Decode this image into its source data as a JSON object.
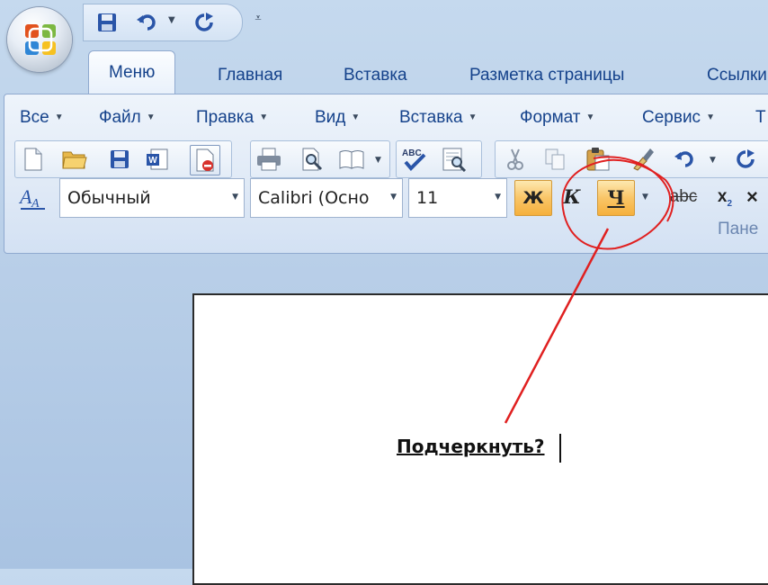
{
  "quick_access": {
    "items": [
      "save-icon",
      "undo-icon",
      "redo-icon"
    ],
    "customize_icon": "customize-qat-icon"
  },
  "tabs": [
    "Меню",
    "Главная",
    "Вставка",
    "Разметка страницы",
    "Ссылки"
  ],
  "menu": [
    "Все",
    "Файл",
    "Правка",
    "Вид",
    "Вставка",
    "Формат",
    "Сервис",
    "Т"
  ],
  "toolbar": {
    "style_value": "Обычный",
    "font_value": "Calibri (Осно",
    "size_value": "11",
    "bold_label": "Ж",
    "italic_label": "К",
    "underline_label": "Ч",
    "strike_label": "abc",
    "subscript_label": "x",
    "subscript_sub": "2",
    "clear_label": "×"
  },
  "panel_label": "Пане",
  "document": {
    "text": "Подчеркнуть?"
  },
  "colors": {
    "ribbon_text": "#15428b",
    "active_button": "#f9c567",
    "annotation": "#e02020"
  }
}
